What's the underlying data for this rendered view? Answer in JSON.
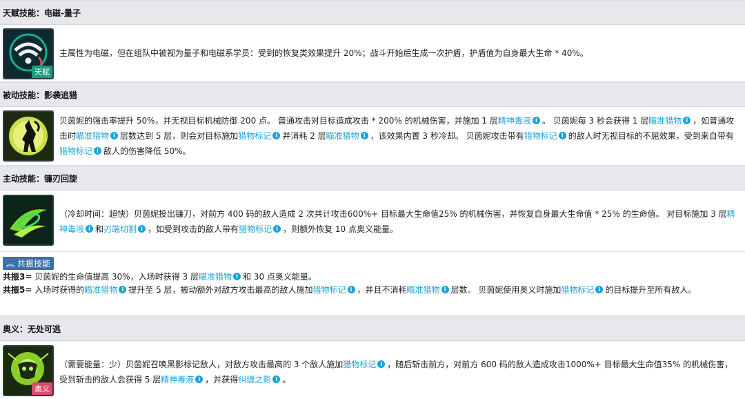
{
  "sections": {
    "talent": {
      "title": "天赋技能：电磁-量子",
      "badge": "天赋",
      "text": "主属性为电磁，但在组队中被视为量子和电磁系学员：受到的恢复类效果提升 20%；战斗开始后生成一次护盾，护盾值为自身最大生命 * 40%。"
    },
    "passive": {
      "title": "被动技能：影袭追猎",
      "p1": "贝茵妮的强击率提升 50%，并无视目标机械防御 200 点。 普通攻击对目标造成攻击 * 200% 的机械伤害，并施加 1 层",
      "k1": "精神毒液",
      "p2": "。 贝茵妮每 3 秒会获得 1 层",
      "k2": "瞄准猎物",
      "p3": "，如普通攻击时",
      "k3": "瞄准猎物",
      "p4": "层数达到 5 层，则会对目标施加",
      "k4": "猎物标记",
      "p5": "并消耗 2 层",
      "k5": "瞄准猎物",
      "p6": "，该效果内置 3 秒冷却。 贝茵妮攻击带有",
      "k6": "猎物标记",
      "p7": "的敌人时无视目标的不屈效果，受到来自带有",
      "k7": "猎物标记",
      "p8": "敌人的伤害降低 50%。"
    },
    "active": {
      "title": "主动技能：镰刃回旋",
      "p1": "（冷却时间：超快）贝茵妮投出镰刀，对前方 400 码的敌人造成 2 次共计攻击600%+ 目标最大生命值25% 的机械伤害，并恢复自身最大生命值 * 25% 的生命值。 对目标施加 3 层",
      "k1": "精神毒液",
      "p2": "和",
      "k2": "刃端切割",
      "p3": "，如受到攻击的敌人带有",
      "k3": "猎物标记",
      "p4": "，则额外恢复 10 点奥义能量。"
    },
    "resonance": {
      "tag": "共振技能",
      "r3_label": "共振3=",
      "r3_p1": " 贝茵妮的生命值提高 30%，入场时获得 3 层",
      "r3_k1": "瞄准猎物",
      "r3_p2": "和 30 点奥义能量。",
      "r5_label": "共振5=",
      "r5_p1": " 入场时获得的",
      "r5_k1": "瞄准猎物",
      "r5_p2": "提升至 5 层，被动额外对敌方攻击最高的敌人施加",
      "r5_k2": "猎物标记",
      "r5_p3": "，并且不消耗",
      "r5_k3": "瞄准猎物",
      "r5_p4": "层数。 贝茵妮使用奥义时施加",
      "r5_k4": "猎物标记",
      "r5_p5": "的目标提升至所有敌人。"
    },
    "ultimate": {
      "title": "奥义：无处可逃",
      "badge": "奥义",
      "p1": "（需要能量：少）贝茵妮召唤黑影标记敌人，对敌方攻击最高的 3 个敌人施加",
      "k1": "猎物标记",
      "p2": "，随后斩击前方，对前方 600 码的敌人造成攻击1000%+ 目标最大生命值35% 的机械伤害，受到斩击的敌人会获得 5 层",
      "k2": "精神毒液",
      "p3": "，并获得",
      "k3": "纠缠之影",
      "p4": "。"
    }
  },
  "info_glyph": "i",
  "resonance_icon": "double-chevron-up-icon",
  "colors": {
    "keyword": "#1aa3d8",
    "header_bg": "#e6e8ec",
    "resonance_tag": "#3e6fa6",
    "talent_badge": "#1a9c7a",
    "ultimate_badge": "#d84c6a"
  }
}
